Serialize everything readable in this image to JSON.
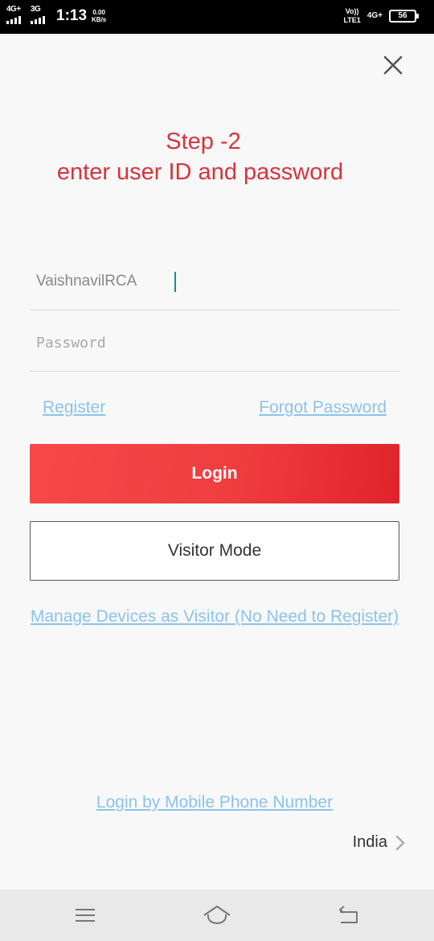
{
  "status_bar": {
    "sim1_network": "4G+",
    "sim2_network": "3G",
    "time": "1:13",
    "speed_value": "0.00",
    "speed_unit": "KB/s",
    "volte_top": "Vo))",
    "volte_bottom": "LTE1",
    "network_right": "4G+",
    "battery_level": "56"
  },
  "header": {
    "close_icon": "close-icon"
  },
  "annotation": {
    "step": "Step -2",
    "instruction": "enter user ID and password"
  },
  "login_form": {
    "user_id_value": "VaishnavilRCA",
    "password_placeholder": "Password",
    "register_label": "Register",
    "forgot_password_label": "Forgot Password",
    "login_button_label": "Login",
    "visitor_mode_label": "Visitor Mode",
    "manage_devices_label": "Manage Devices as Visitor (No Need to Register)",
    "mobile_login_label": "Login by Mobile Phone Number"
  },
  "region": {
    "label": "India"
  },
  "nav_bar": {
    "icons": [
      "menu-icon",
      "home-icon",
      "back-icon"
    ]
  },
  "colors": {
    "accent_red": "#e8353a",
    "annotation_red": "#d8333c",
    "link_blue": "#8cc3ea",
    "cursor_green": "#17937b"
  }
}
